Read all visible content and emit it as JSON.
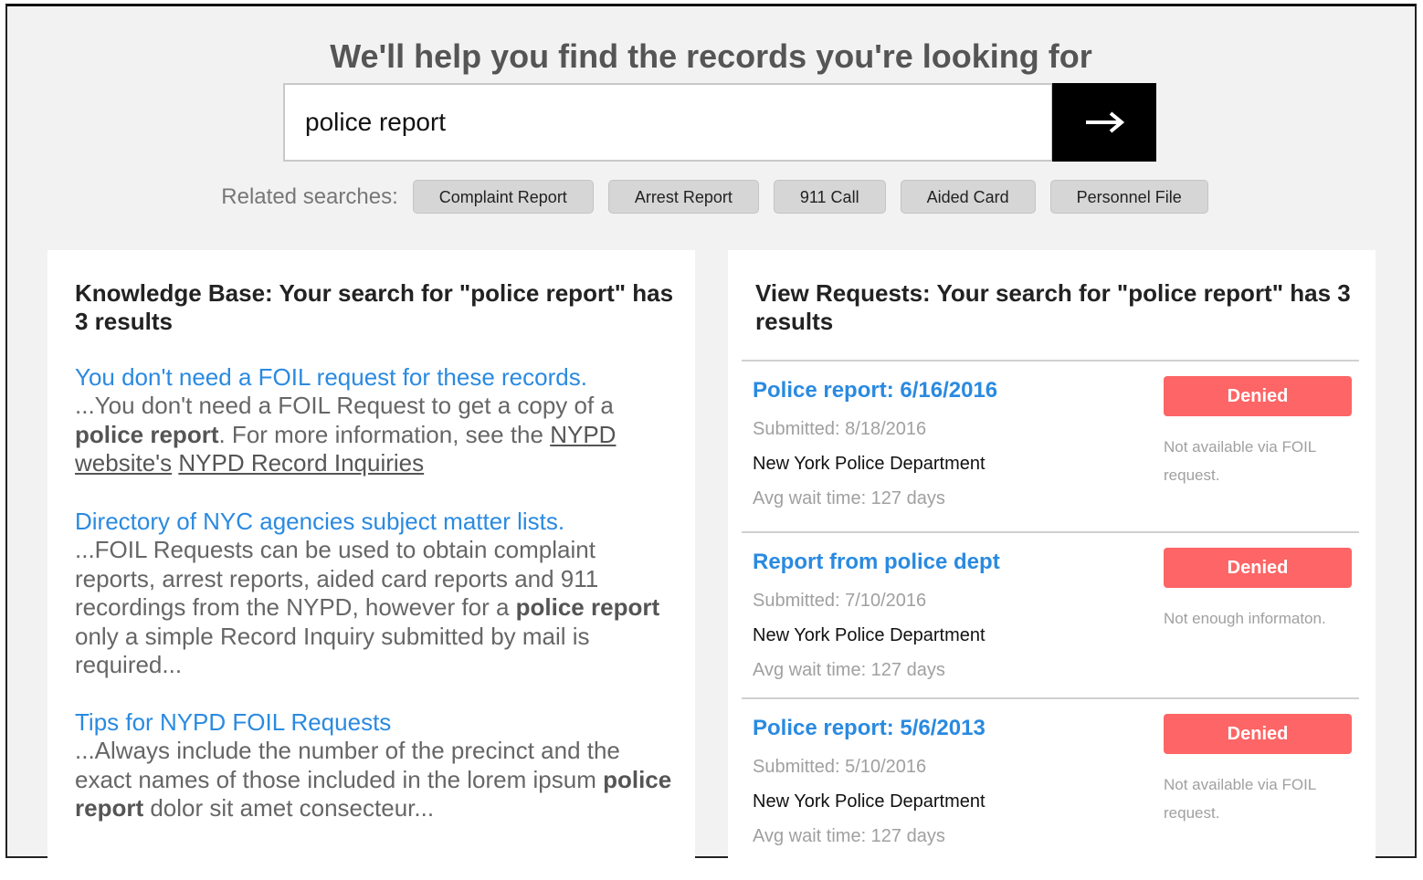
{
  "header": {
    "title": "We'll help you find the records you're looking for"
  },
  "search": {
    "value": "police report",
    "button_icon": "arrow-right-icon"
  },
  "related": {
    "label": "Related searches:",
    "items": [
      "Complaint Report",
      "Arrest Report",
      "911 Call",
      "Aided Card",
      "Personnel File"
    ]
  },
  "knowledge_base": {
    "title": "Knowledge Base: Your search for \"police report\" has 3 results",
    "results": [
      {
        "link": "You don't need a FOIL request for these records.",
        "snippet_pre": "...You don't need a FOIL Request to get a copy of a ",
        "snippet_bold": "police report",
        "snippet_post": ". For more information, see the ",
        "snippet_link1": "NYPD website's",
        "snippet_sep": " ",
        "snippet_link2": "NYPD Record Inquiries"
      },
      {
        "link": "Directory of NYC agencies subject matter lists.",
        "snippet_pre": "...FOIL Requests can be used to obtain complaint reports, arrest reports, aided card reports and 911 recordings from the NYPD, however for a ",
        "snippet_bold": "police report",
        "snippet_post": " only a simple Record Inquiry submitted by mail is required..."
      },
      {
        "link": "Tips for NYPD FOIL Requests",
        "snippet_pre": "...Always include the number of the precinct and the exact names of those included in the lorem ipsum ",
        "snippet_bold": "police report",
        "snippet_post": " dolor sit amet consecteur..."
      }
    ]
  },
  "view_requests": {
    "title": "View Requests: Your search for \"police report\" has 3 results",
    "requests": [
      {
        "title": "Police report: 6/16/2016",
        "submitted": "Submitted: 8/18/2016",
        "agency": "New York Police Department",
        "wait": "Avg wait time: 127 days",
        "status": "Denied",
        "note": "Not available via FOIL request."
      },
      {
        "title": "Report from police dept",
        "submitted": "Submitted: 7/10/2016",
        "agency": "New York Police Department",
        "wait": "Avg wait time: 127 days",
        "status": "Denied",
        "note": "Not enough informaton."
      },
      {
        "title": "Police report: 5/6/2013",
        "submitted": "Submitted: 5/10/2016",
        "agency": "New York Police Department",
        "wait": "Avg wait time: 127 days",
        "status": "Denied",
        "note": "Not available via FOIL request."
      }
    ]
  },
  "colors": {
    "link": "#2a8ae0",
    "denied": "#fd6566",
    "background": "#f2f2f2"
  }
}
